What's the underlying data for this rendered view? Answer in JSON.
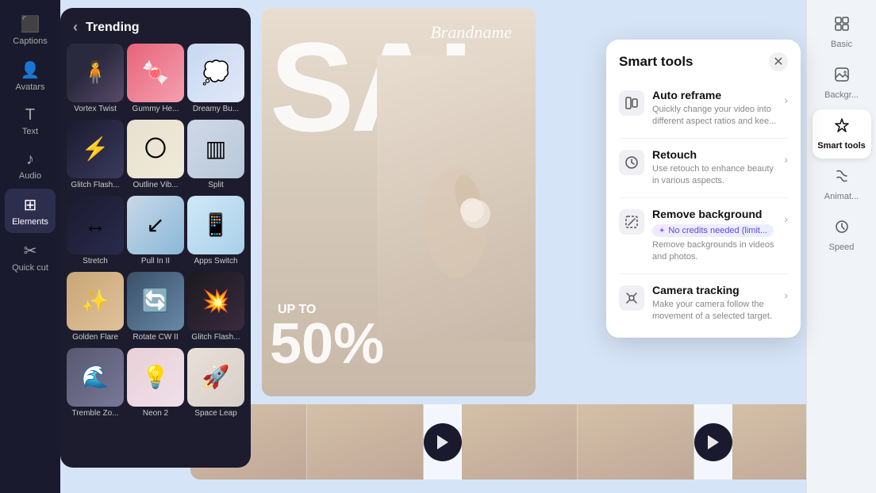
{
  "sidebar": {
    "items": [
      {
        "label": "Captions",
        "icon": "⬛",
        "active": false
      },
      {
        "label": "Avatars",
        "icon": "👤",
        "active": false
      },
      {
        "label": "Text",
        "icon": "T",
        "active": false
      },
      {
        "label": "Audio",
        "icon": "♪",
        "active": false
      },
      {
        "label": "Elements",
        "icon": "⊞",
        "active": true
      },
      {
        "label": "Quick cut",
        "icon": "✂",
        "active": false
      }
    ]
  },
  "trending": {
    "title": "Trending",
    "items": [
      {
        "label": "Vortex Twist",
        "thumbClass": "thumb-vortex"
      },
      {
        "label": "Gummy He...",
        "thumbClass": "thumb-gummy"
      },
      {
        "label": "Dreamy Bu...",
        "thumbClass": "thumb-dreamy"
      },
      {
        "label": "Glitch Flash...",
        "thumbClass": "thumb-glitch"
      },
      {
        "label": "Outline Vib...",
        "thumbClass": "thumb-outline"
      },
      {
        "label": "Split",
        "thumbClass": "thumb-split"
      },
      {
        "label": "Stretch",
        "thumbClass": "thumb-stretch"
      },
      {
        "label": "Pull In II",
        "thumbClass": "thumb-pullin"
      },
      {
        "label": "Apps Switch",
        "thumbClass": "thumb-apps"
      },
      {
        "label": "Golden Flare",
        "thumbClass": "thumb-golden"
      },
      {
        "label": "Rotate CW II",
        "thumbClass": "thumb-rotate"
      },
      {
        "label": "Glitch Flash...",
        "thumbClass": "thumb-glitch2"
      },
      {
        "label": "Tremble Zo...",
        "thumbClass": "thumb-tremble"
      },
      {
        "label": "Neon 2",
        "thumbClass": "thumb-neon"
      },
      {
        "label": "Space Leap",
        "thumbClass": "thumb-space"
      }
    ]
  },
  "canvas": {
    "brandname": "Brandname",
    "sale_text": "SAL",
    "up_to": "UP TO",
    "percent": "50%"
  },
  "smart_tools": {
    "title": "Smart tools",
    "close_label": "✕",
    "tools": [
      {
        "name": "Auto reframe",
        "desc": "Quickly change your video into different aspect ratios and kee...",
        "icon": "⬜"
      },
      {
        "name": "Retouch",
        "desc": "Use retouch to enhance beauty in various aspects.",
        "icon": "📷"
      },
      {
        "name": "Remove background",
        "credits_label": "✦ No credits needed (limit...",
        "desc": "Remove backgrounds in videos and photos.",
        "icon": "🔲",
        "has_credits": true
      },
      {
        "name": "Camera tracking",
        "desc": "Make your camera follow the movement of a selected target.",
        "icon": "🎯"
      }
    ]
  },
  "right_sidebar": {
    "items": [
      {
        "label": "Basic",
        "icon": "⊞",
        "active": false
      },
      {
        "label": "Backgr...",
        "icon": "▦",
        "active": false
      },
      {
        "label": "Smart tools",
        "icon": "✦",
        "active": true
      },
      {
        "label": "Animat...",
        "icon": "◎",
        "active": false
      },
      {
        "label": "Speed",
        "icon": "⏱",
        "active": false
      }
    ]
  }
}
